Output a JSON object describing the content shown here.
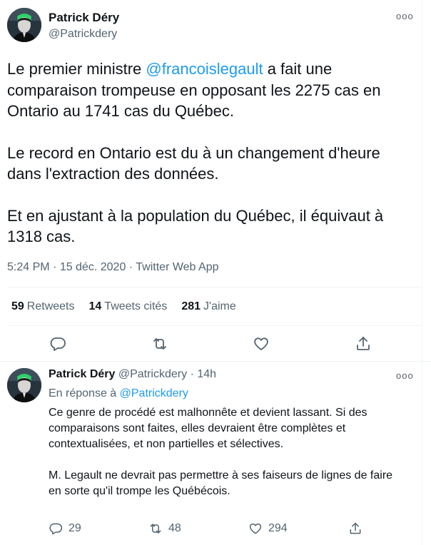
{
  "main_tweet": {
    "author_name": "Patrick Déry",
    "author_handle": "@Patrickdery",
    "more_label": "ooo",
    "paragraph1_before": "Le premier ministre ",
    "paragraph1_mention": "@francoislegault",
    "paragraph1_after": " a fait une comparaison trompeuse en opposant les 2275 cas en Ontario au 1741 cas du Québec.",
    "paragraph2": "Le record en Ontario est du à un changement d'heure dans l'extraction des données.",
    "paragraph3": "Et en ajustant à la population du Québec, il équivaut à 1318 cas.",
    "time": "5:24 PM",
    "date": "15 déc. 2020",
    "source": "Twitter Web App",
    "separator": " · ",
    "retweets_count": "59",
    "retweets_label": "Retweets",
    "quotes_count": "14",
    "quotes_label": "Tweets cités",
    "likes_count": "281",
    "likes_label": "J'aime"
  },
  "reply_tweet": {
    "author_name": "Patrick Déry",
    "author_handle": "@Patrickdery",
    "time_ago": "· 14h",
    "more_label": "ooo",
    "reply_prefix": "En réponse à ",
    "reply_mention": "@Patrickdery",
    "paragraph1": "Ce genre de procédé est malhonnête et devient lassant. Si des comparaisons sont faites, elles devraient être complètes et contextualisées, et non partielles et sélectives.",
    "paragraph2": "M. Legault ne devrait pas permettre à ses faiseurs de lignes de faire en sorte qu'il trompe les Québécois.",
    "reply_count": "29",
    "retweet_count": "48",
    "like_count": "294"
  },
  "colors": {
    "accent": "#1d9bf0",
    "secondary_text": "#536471",
    "primary_text": "#0f1419"
  },
  "icons": [
    "reply-icon",
    "retweet-icon",
    "like-icon",
    "share-icon",
    "more-icon"
  ]
}
